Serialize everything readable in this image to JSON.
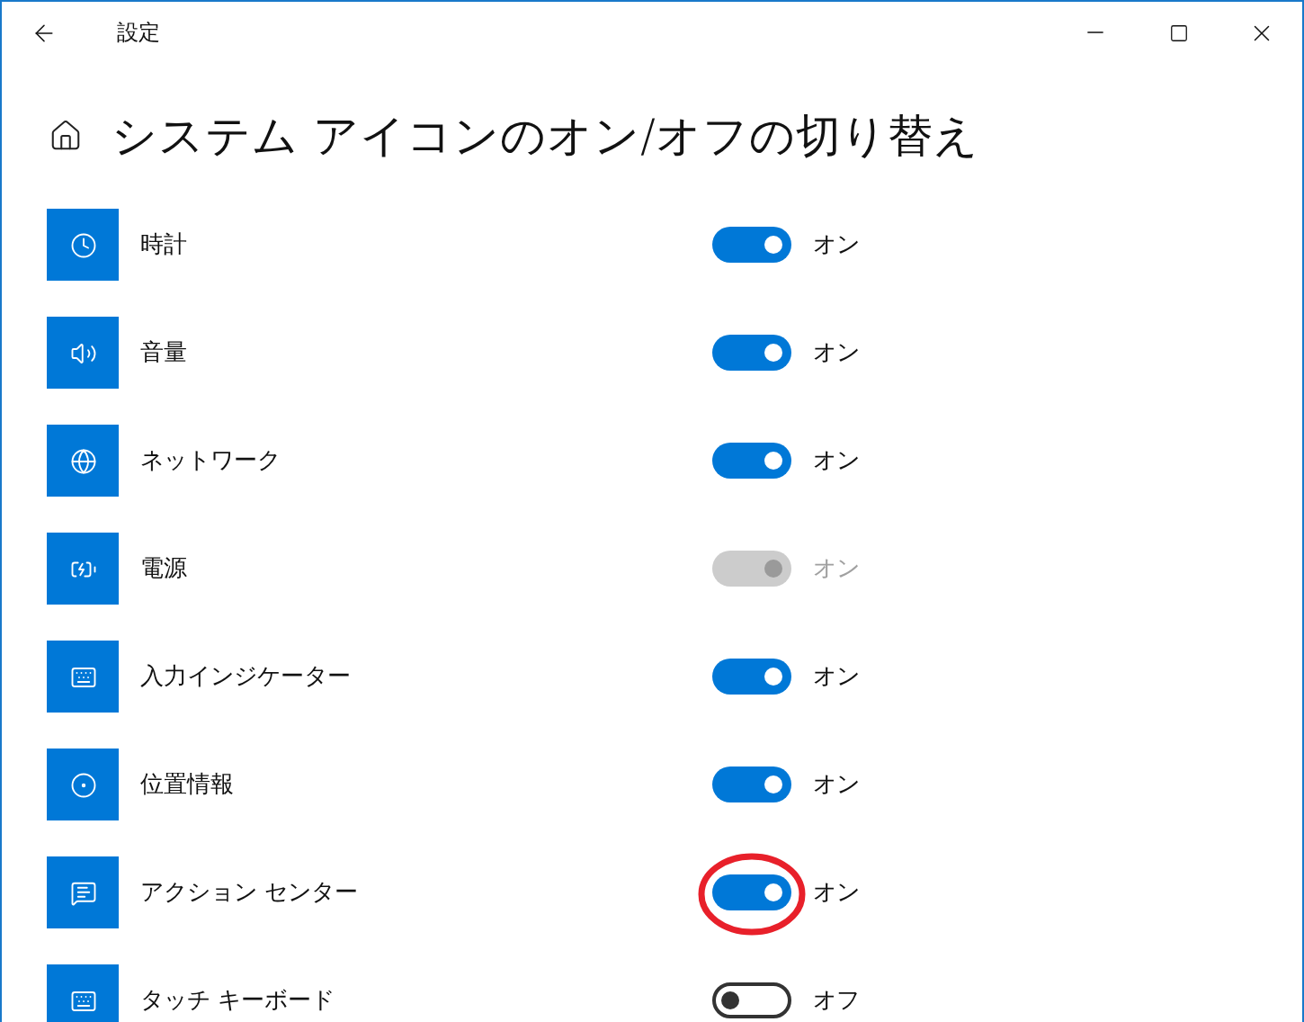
{
  "window": {
    "title": "設定"
  },
  "page": {
    "heading": "システム アイコンのオン/オフの切り替え"
  },
  "items": [
    {
      "label": "時計",
      "on": true,
      "disabled": false,
      "state_label": "オン",
      "circled": false
    },
    {
      "label": "音量",
      "on": true,
      "disabled": false,
      "state_label": "オン",
      "circled": false
    },
    {
      "label": "ネットワーク",
      "on": true,
      "disabled": false,
      "state_label": "オン",
      "circled": false
    },
    {
      "label": "電源",
      "on": true,
      "disabled": true,
      "state_label": "オン",
      "circled": false
    },
    {
      "label": "入力インジケーター",
      "on": true,
      "disabled": false,
      "state_label": "オン",
      "circled": false
    },
    {
      "label": "位置情報",
      "on": true,
      "disabled": false,
      "state_label": "オン",
      "circled": false
    },
    {
      "label": "アクション センター",
      "on": true,
      "disabled": false,
      "state_label": "オン",
      "circled": true
    },
    {
      "label": "タッチ キーボード",
      "on": false,
      "disabled": false,
      "state_label": "オフ",
      "circled": false
    }
  ]
}
